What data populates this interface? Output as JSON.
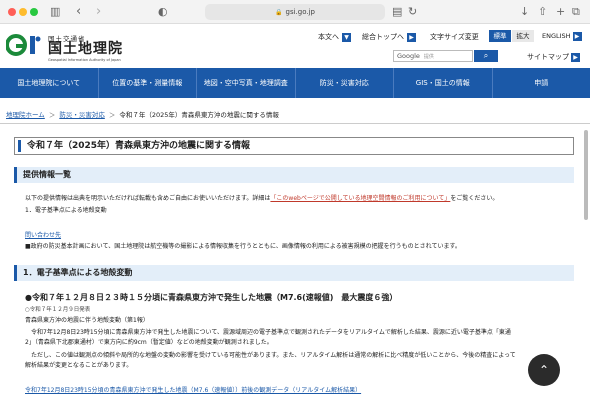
{
  "browser": {
    "url": "gsi.go.jp",
    "icons": {
      "sidebar": "sidebar-icon",
      "back": "‹",
      "forward": "›",
      "shield": "◐",
      "reader": "▤",
      "reload": "↻",
      "download": "↓",
      "share": "⇧",
      "newtab": "+",
      "tabs": "⧉"
    }
  },
  "header": {
    "logo_ministry": "国土交通省",
    "logo_name": "国土地理院",
    "logo_en": "Geospatial Information Authority of Japan",
    "links": [
      "本文へ",
      "総合トップへ",
      "文字サイズ変更"
    ],
    "size_standard": "標準",
    "size_large": "拡大",
    "english": "ENGLISH",
    "search_brand": "Google",
    "search_placeholder": "提供",
    "sitemap": "サイトマップ"
  },
  "nav": {
    "items": [
      "国土地理院について",
      "位置の基準・測量情報",
      "地図・空中写真・地理調査",
      "防災・災害対応",
      "GIS・国土の情報",
      "申請"
    ]
  },
  "breadcrumb": {
    "home": "地理院ホーム",
    "level1": "防災・災害対応",
    "current": "令和７年（2025年）青森県東方沖の地震に関する情報"
  },
  "page": {
    "title": "令和７年（2025年）青森県東方沖の地震に関する情報",
    "section1": {
      "heading": "提供情報一覧",
      "line1_pre": "以下の提供情報は出典を明示いただければ転載も含めご自由にお使いいただけます。詳細は",
      "line1_link": "「このwebページで公開している地理空間情報のご利用について」",
      "line1_post": "をご覧ください。",
      "item1": "1．電子基準点による地殻変動",
      "inquiry": "問い合わせ先",
      "note": "■政府の防災基本計画において、国土地理院は航空機等の撮影による情報収集を行うとともに、画像情報の利用による被害規模の把握を行うものとされています。"
    },
    "section2": {
      "heading": "1．電子基準点による地殻変動",
      "subheading": "●令和７年１２月８日２３時１５分頃に青森県東方沖で発生した地震（M7.6(速報値)　最大震度６強）",
      "date": "○令和７年１２月９日発表",
      "report_title": "青森県東方沖の地震に伴う地殻変動（第1報）",
      "para1": "　令和7年12月8日23時15分頃に青森県東方沖で発生した地震について、震源域周辺の電子基準点で観測されたデータをリアルタイムで解析した結果、震源に近い電子基準点「東通",
      "para2": "2」（青森県下北郡東通村）で東方向に約9cm（暫定値）などの地殻変動が観測されました。",
      "para3": "　ただし、この値は観測点の傾斜や局所的な地盤の変動の影響を受けている可能性があります。また、リアルタイム解析は通常の解析に比べ精度が低いことから、今後の精査によって",
      "para4": "解析結果が変更となることがあります。",
      "bottom_link": "令和7年12月8日23時15分頃の青森県東方沖で発生した地震（M7.6（速報値））前後の観測データ（リアルタイム解析結果）"
    }
  },
  "back_to_top": "⌃",
  "colors": {
    "brand_blue": "#1b59a8",
    "section_bg": "#e3eef9",
    "link_orange": "#c0392b"
  }
}
